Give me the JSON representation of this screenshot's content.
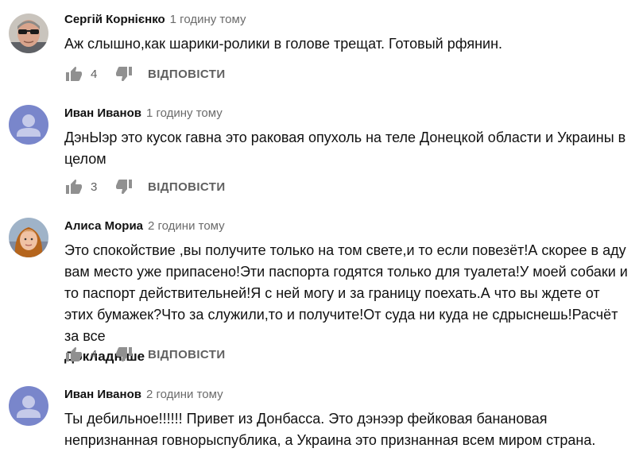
{
  "comments": [
    {
      "author": "Сергій Корнієнко",
      "time": "1 годину тому",
      "text": "Аж слышно,как шарики-ролики в голове трещат. Готовый рфянин.",
      "likes": "4",
      "reply_label": "ВІДПОВІСТИ",
      "avatar": "photo-avatar-man-sunglasses"
    },
    {
      "author": "Иван Иванов",
      "time": "1 годину тому",
      "text": "ДэнЫэр это кусок гавна это раковая опухоль на теле Донецкой области и Украины в целом",
      "likes": "3",
      "reply_label": "ВІДПОВІСТИ",
      "avatar": "default-avatar"
    },
    {
      "author": "Алиса Мориа",
      "time": "2 години тому",
      "text": "Это спокойствие ,вы получите только на том свете,и то если повезёт!А скорее в аду вам место уже припасено!Эти паспорта годятся только для туалета!У моей собаки и то паспорт действительней!Я с ней могу и за границу поехать.А что вы ждете от этих бумажек?Что за служили,то и получите!От суда ни куда не сдрыснешь!Расчёт за все",
      "more_label": "Докладніше",
      "likes": "4",
      "reply_label": "ВІДПОВІСТИ",
      "avatar": "photo-avatar-woman"
    },
    {
      "author": "Иван Иванов",
      "time": "2 години тому",
      "text": "Ты дебильное!!!!!! Привет из Донбасса. Это дэнээр фейковая банановая непризнанная говнорыспублика, а Украина это признанная всем миром страна.",
      "avatar": "default-avatar"
    }
  ],
  "icons": {
    "like": "thumb-up-icon",
    "dislike": "thumb-down-icon"
  },
  "colors": {
    "default_avatar_bg": "#7986cb",
    "secondary_text": "#606060"
  }
}
